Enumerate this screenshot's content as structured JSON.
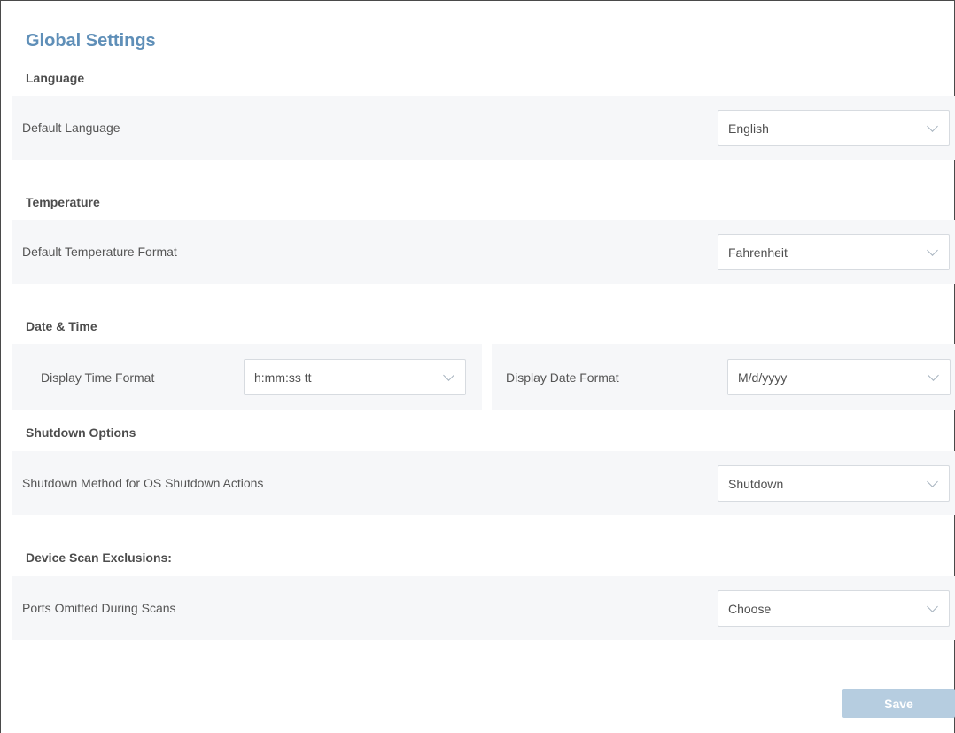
{
  "page": {
    "title": "Global Settings"
  },
  "sections": {
    "language": {
      "title": "Language",
      "label": "Default Language",
      "value": "English"
    },
    "temperature": {
      "title": "Temperature",
      "label": "Default Temperature Format",
      "value": "Fahrenheit"
    },
    "datetime": {
      "title": "Date & Time",
      "time_label": "Display Time Format",
      "time_value": "h:mm:ss tt",
      "date_label": "Display Date Format",
      "date_value": "M/d/yyyy"
    },
    "shutdown": {
      "title": "Shutdown Options",
      "label": "Shutdown Method for OS Shutdown Actions",
      "value": "Shutdown"
    },
    "exclusions": {
      "title": "Device Scan Exclusions:",
      "label": "Ports Omitted During Scans",
      "value": "Choose"
    }
  },
  "actions": {
    "save_label": "Save"
  },
  "colors": {
    "title": "#5f8fb8",
    "row_background": "#f6f7f9",
    "save_button": "#b6cde0"
  }
}
